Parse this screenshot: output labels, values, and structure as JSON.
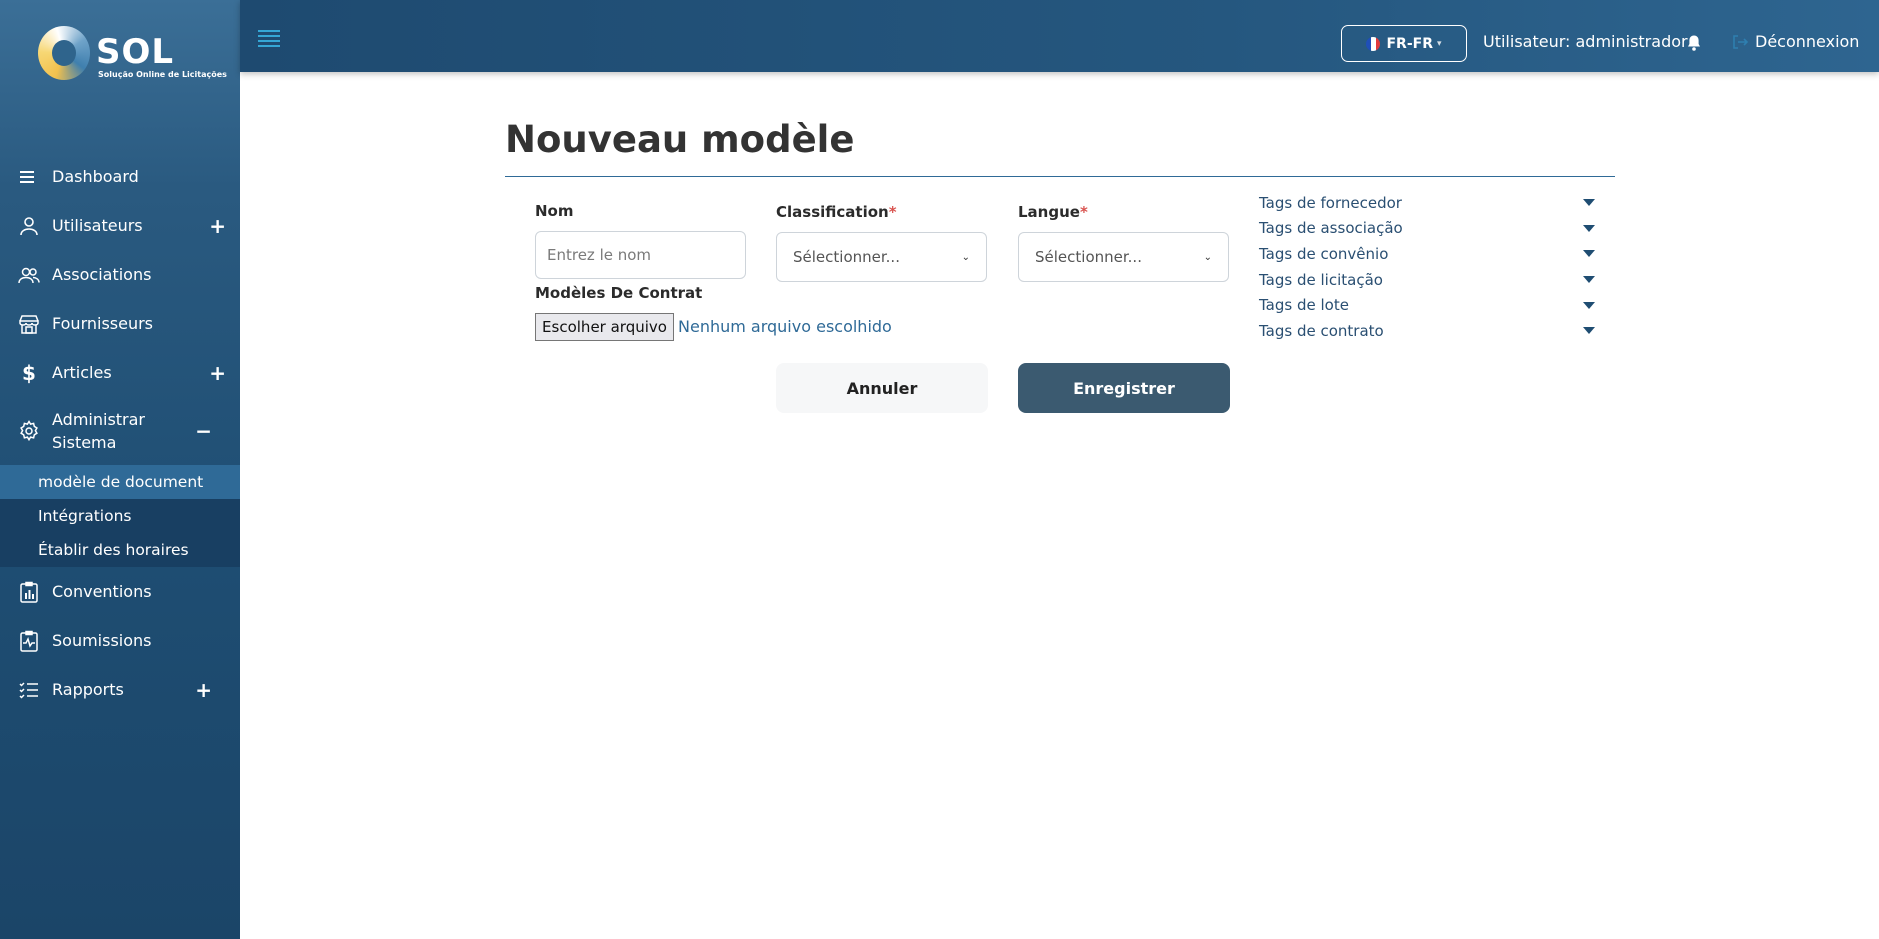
{
  "brand": {
    "name": "SOL",
    "tagline": "Solução Online de Licitações"
  },
  "sidebar": {
    "items": [
      {
        "label": "Dashboard",
        "icon": "menu-lines-icon"
      },
      {
        "label": "Utilisateurs",
        "icon": "user-icon",
        "toggle": "+"
      },
      {
        "label": "Associations",
        "icon": "users-icon"
      },
      {
        "label": "Fournisseurs",
        "icon": "store-icon"
      },
      {
        "label": "Articles",
        "icon": "dollar-icon",
        "toggle": "+"
      },
      {
        "label": "Administrar Sistema",
        "icon": "gear-icon",
        "toggle": "−"
      },
      {
        "label": "Conventions",
        "icon": "clipboard-chart-icon"
      },
      {
        "label": "Soumissions",
        "icon": "clipboard-pulse-icon"
      },
      {
        "label": "Rapports",
        "icon": "checklist-icon",
        "toggle": "+"
      }
    ],
    "subitems": [
      {
        "label": "modèle de document",
        "active": true
      },
      {
        "label": "Intégrations"
      },
      {
        "label": "Établir des horaires"
      }
    ]
  },
  "topbar": {
    "language": "FR-FR",
    "user": "Utilisateur: administrador",
    "logout": "Déconnexion"
  },
  "main": {
    "title": "Nouveau modèle",
    "form": {
      "name_label": "Nom",
      "name_placeholder": "Entrez le nom",
      "classification_label": "Classification",
      "classification_value": "Sélectionner...",
      "language_label": "Langue",
      "language_value": "Sélectionner...",
      "required_mark": "*",
      "contract_label": "Modèles De Contrat",
      "file_button": "Escolher arquivo",
      "file_status": "Nenhum arquivo escolhido"
    },
    "buttons": {
      "cancel": "Annuler",
      "save": "Enregistrer"
    },
    "tags": [
      "Tags de fornecedor",
      "Tags de associação",
      "Tags de convênio",
      "Tags de licitação",
      "Tags de lote",
      "Tags de contrato"
    ]
  },
  "colors": {
    "sidebar": "#1e4d72",
    "topbar": "#25577f",
    "primary_button": "#3b5a70",
    "accent": "#2f6a97",
    "required": "#d9534f"
  }
}
